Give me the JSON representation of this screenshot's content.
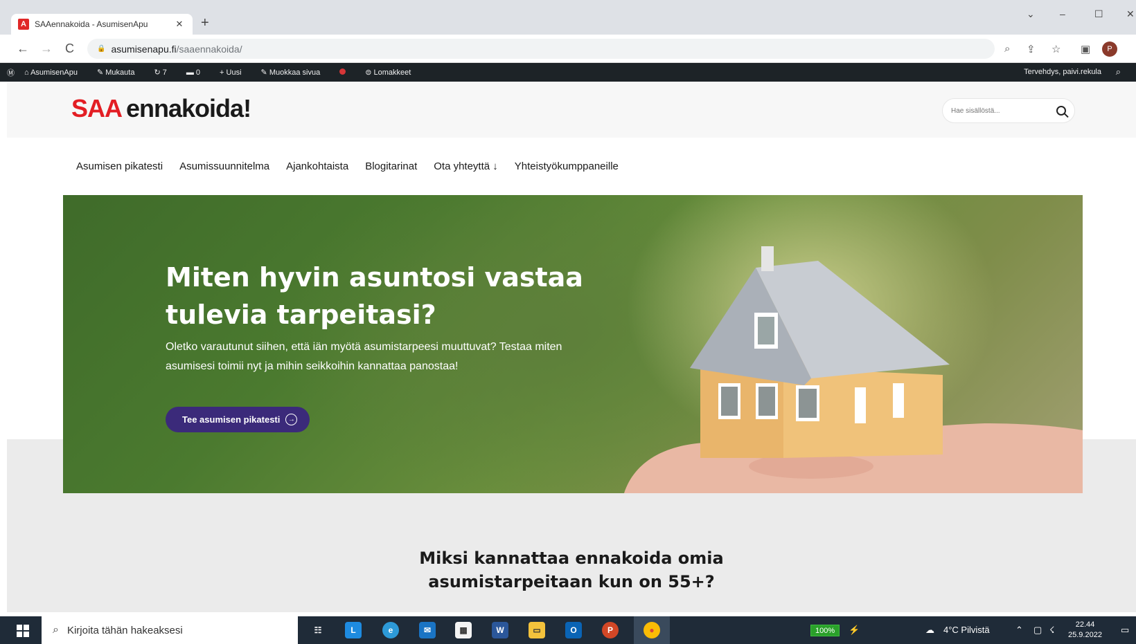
{
  "browser": {
    "tab_title": "SAAennakoida - AsumisenApu",
    "tab_close": "✕",
    "new_tab": "+",
    "favicon_letter": "A",
    "url_host": "asumisenapu.fi",
    "url_path": "/saaennakoida/",
    "back": "←",
    "forward": "→",
    "reload": "C",
    "lock": "🔒",
    "profile_letter": "P",
    "win_collapse": "⌄",
    "win_min": "–",
    "win_max": "☐",
    "win_close": "✕"
  },
  "wpbar": {
    "site": "AsumisenApu",
    "customize": "Mukauta",
    "updates": "7",
    "comments": "0",
    "new": "Uusi",
    "edit": "Muokkaa sivua",
    "forms": "Lomakkeet",
    "greeting": "Tervehdys, paivi.rekula"
  },
  "site": {
    "logo_red": "SAA",
    "logo_dark": "ennakoida!",
    "search_placeholder": "Hae sisällöstä...",
    "nav": [
      "Asumisen pikatesti",
      "Asumissuunnitelma",
      "Ajankohtaista",
      "Blogitarinat",
      "Ota yhteyttä ↓",
      "Yhteistyökumppaneille"
    ]
  },
  "hero": {
    "title": "Miten hyvin asuntosi vastaa tulevia tarpeitasi?",
    "text": "Oletko varautunut siihen, että iän myötä asumistarpeesi muuttuvat? Testaa miten asumisesi toimii nyt ja mihin seikkoihin kannattaa panostaa!",
    "button": "Tee asumisen pikatesti",
    "button_icon": "→"
  },
  "section": {
    "heading": "Miksi kannattaa ennakoida omia asumistarpeitaan kun on 55+?"
  },
  "taskbar": {
    "search_placeholder": "Kirjoita tähän hakeaksesi",
    "battery": "100%",
    "weather": "4°C  Pilvistä",
    "time": "22.44",
    "date": "25.9.2022"
  },
  "colors": {
    "logo_red": "#e31e24",
    "button_purple": "#3b2a7a",
    "wpbar": "#1d2327"
  }
}
